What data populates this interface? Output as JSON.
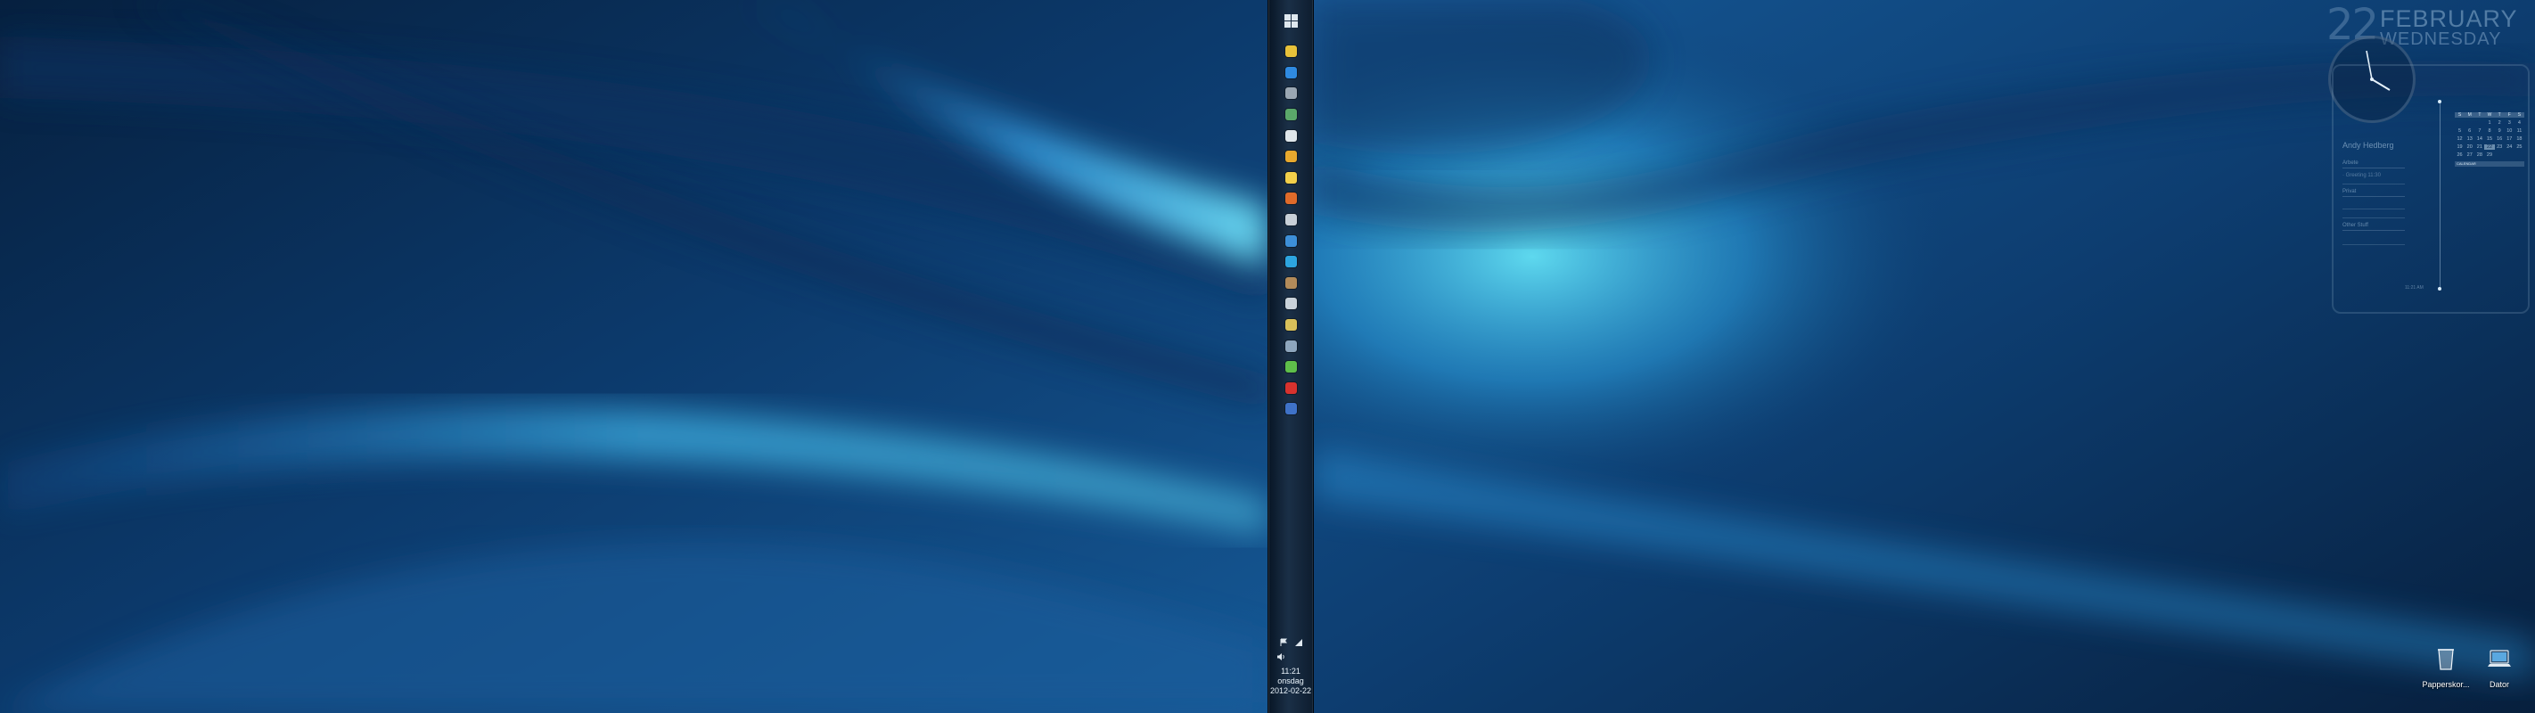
{
  "taskbar": {
    "start_icon": "windows-start-icon",
    "icons": [
      {
        "name": "chrome-icon",
        "color": "#e8c23a"
      },
      {
        "name": "explorer-icon",
        "color": "#2f8ae0"
      },
      {
        "name": "calculator-icon",
        "color": "#9aa7b3"
      },
      {
        "name": "photo-viewer-icon",
        "color": "#5aa86a"
      },
      {
        "name": "lightning-icon",
        "color": "#dfe6ea"
      },
      {
        "name": "folder-icon",
        "color": "#e8a92e"
      },
      {
        "name": "notes-icon",
        "color": "#f2cf4a"
      },
      {
        "name": "firefox-icon",
        "color": "#e06b2a"
      },
      {
        "name": "steam-icon",
        "color": "#c8d0d8"
      },
      {
        "name": "dropbox-icon",
        "color": "#3d8fd8"
      },
      {
        "name": "skype-icon",
        "color": "#2da5e0"
      },
      {
        "name": "app-icon",
        "color": "#b28b5a"
      },
      {
        "name": "paint-icon",
        "color": "#c9d2da"
      },
      {
        "name": "document-icon",
        "color": "#d8c05a"
      },
      {
        "name": "media-icon",
        "color": "#8ea6bd"
      },
      {
        "name": "spotify-icon",
        "color": "#5fbf4a"
      },
      {
        "name": "acrobat-icon",
        "color": "#d8322e"
      },
      {
        "name": "word-icon",
        "color": "#3f72c8"
      }
    ],
    "tray": {
      "flag_icon": "action-center-flag-icon",
      "network_icon": "network-signal-icon",
      "volume_icon": "volume-icon",
      "time": "11:21",
      "weekday": "onsdag",
      "date": "2012-02-22"
    }
  },
  "gadgets": {
    "date": {
      "day": "22",
      "month": "FEBRUARY",
      "weekday": "WEDNESDAY"
    },
    "organizer": {
      "name": "Andy Hedberg",
      "sections": [
        {
          "title": "Arbete",
          "items": [
            "Greeting 11:30"
          ]
        },
        {
          "title": "Privat",
          "items": []
        },
        {
          "title": "Other Stuff",
          "items": []
        }
      ],
      "time": "11:21 AM",
      "calendar": {
        "weekdays": [
          "S",
          "M",
          "T",
          "W",
          "T",
          "F",
          "S"
        ],
        "days": [
          "",
          "",
          "",
          "1",
          "2",
          "3",
          "4",
          "5",
          "6",
          "7",
          "8",
          "9",
          "10",
          "11",
          "12",
          "13",
          "14",
          "15",
          "16",
          "17",
          "18",
          "19",
          "20",
          "21",
          "22",
          "23",
          "24",
          "25",
          "26",
          "27",
          "28",
          "29"
        ],
        "today": "22",
        "footer": "CALENDAR"
      }
    }
  },
  "desktop_icons": [
    {
      "name": "recycle-bin-icon",
      "label": "Papperskor..."
    },
    {
      "name": "computer-icon",
      "label": "Dator"
    }
  ]
}
